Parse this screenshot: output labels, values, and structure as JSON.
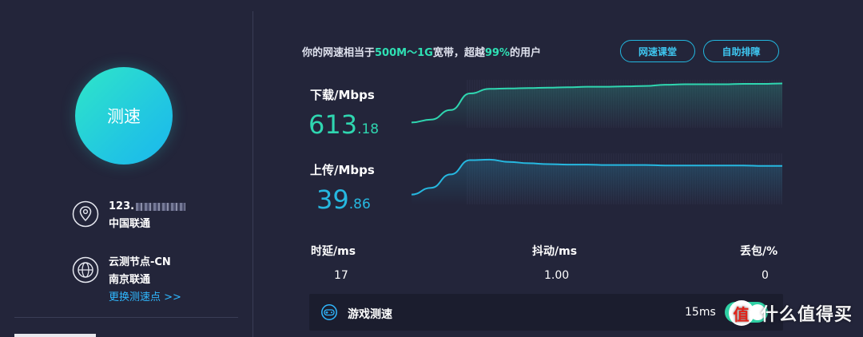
{
  "left": {
    "speed_button_label": "测速",
    "ip_prefix": "123.",
    "isp": "中国联通",
    "node_name": "云测节点-CN",
    "node_isp": "南京联通",
    "change_node_link": "更换测速点 >>"
  },
  "summary": {
    "prefix": "你的网速相当于",
    "bandwidth": "500M～1G",
    "middle": "宽带，超越",
    "percent": "99%",
    "suffix": "的用户"
  },
  "buttons": {
    "course": "网速课堂",
    "troubleshoot": "自助排障"
  },
  "download": {
    "label": "下载/Mbps",
    "value_int": "613",
    "value_dec": ".18",
    "color": "#2fd6b0",
    "samples": [
      0.05,
      0.12,
      0.35,
      0.75,
      0.86,
      0.87,
      0.88,
      0.89,
      0.9,
      0.91,
      0.91,
      0.92,
      0.93,
      0.96,
      0.97,
      0.97,
      0.97,
      0.98,
      0.98,
      0.99
    ]
  },
  "upload": {
    "label": "上传/Mbps",
    "value_int": "39",
    "value_dec": ".86",
    "color": "#26b8e0",
    "samples": [
      0.15,
      0.3,
      0.6,
      0.92,
      0.93,
      0.88,
      0.85,
      0.83,
      0.82,
      0.82,
      0.81,
      0.81,
      0.81,
      0.8,
      0.8,
      0.8,
      0.8,
      0.8,
      0.79,
      0.79
    ]
  },
  "stats": {
    "latency_label": "时延/ms",
    "latency_value": "17",
    "jitter_label": "抖动/ms",
    "jitter_value": "1.00",
    "loss_label": "丢包/%",
    "loss_value": "0"
  },
  "game": {
    "label": "游戏测速",
    "ms": "15ms"
  },
  "watermark": {
    "badge": "值",
    "text": "什么值得买"
  }
}
